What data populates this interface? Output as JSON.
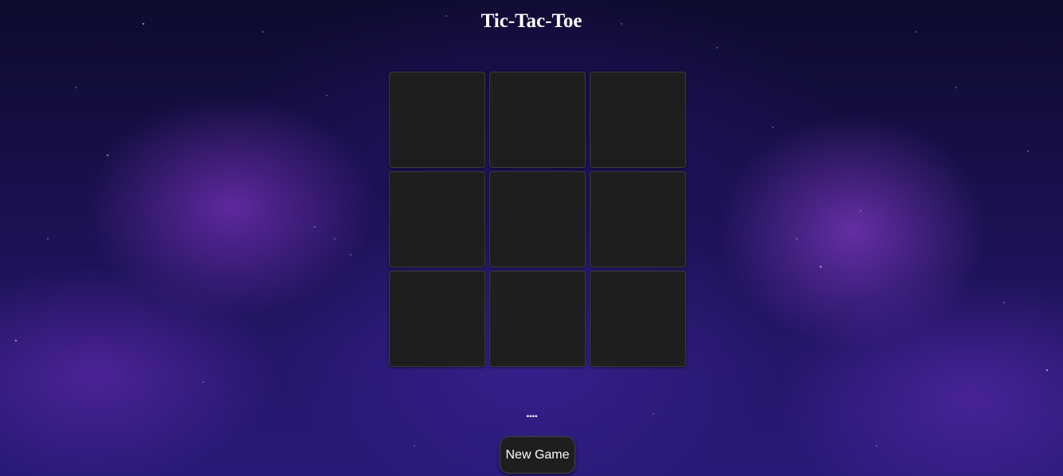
{
  "title": "Tic-Tac-Toe",
  "board": {
    "cells": [
      "",
      "",
      "",
      "",
      "",
      "",
      "",
      "",
      ""
    ]
  },
  "status": "....",
  "new_game_label": "New Game",
  "colors": {
    "cell_bg": "#1e1e1e",
    "text": "#ffffff",
    "background_primary": "#1a1150",
    "nebula_accent": "#9b3fe0"
  }
}
